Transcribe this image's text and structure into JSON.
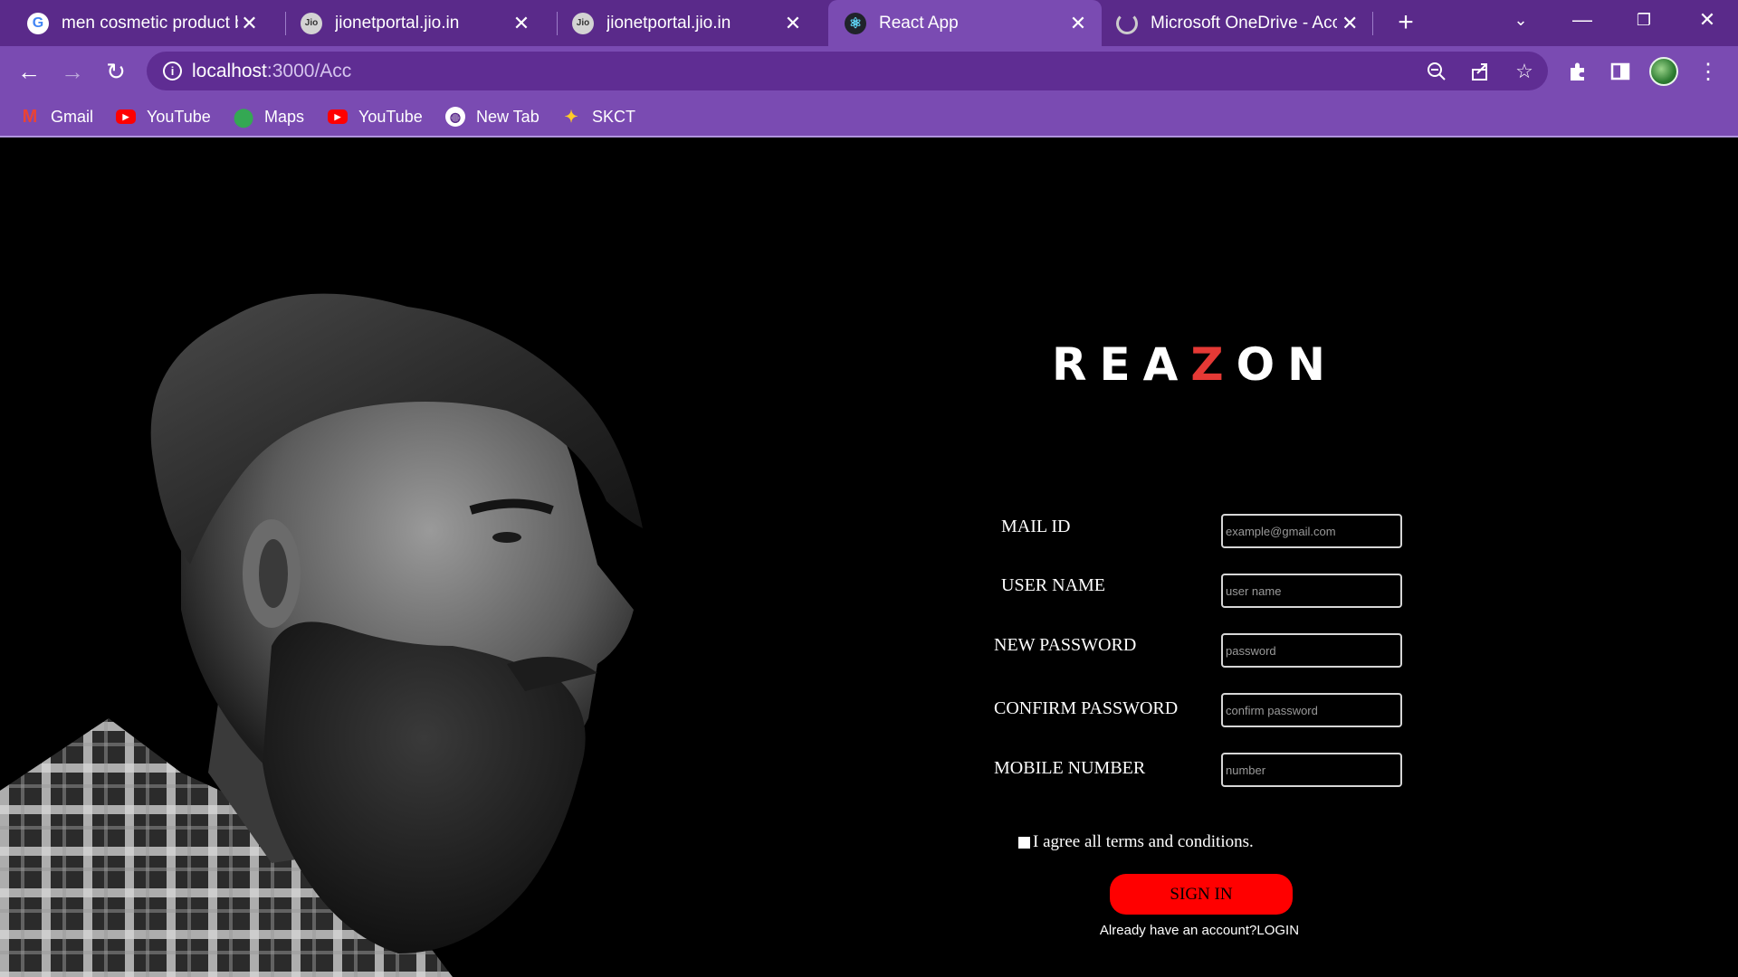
{
  "browser": {
    "tabs": [
      {
        "title": "men cosmetic product bla",
        "favicon": "google-icon"
      },
      {
        "title": "jionetportal.jio.in",
        "favicon": "jio-icon"
      },
      {
        "title": "jionetportal.jio.in",
        "favicon": "jio-icon"
      },
      {
        "title": "React App",
        "favicon": "react-icon",
        "active": true
      },
      {
        "title": "Microsoft OneDrive - Acc",
        "favicon": "loading-spinner-icon"
      }
    ],
    "favicon_text": {
      "google": "G",
      "jio": "Jio",
      "react": "⚛"
    },
    "address": {
      "host": "localhost",
      "path": ":3000/Acc"
    },
    "bookmarks": [
      {
        "label": "Gmail",
        "icon": "gmail-icon"
      },
      {
        "label": "YouTube",
        "icon": "youtube-icon"
      },
      {
        "label": "Maps",
        "icon": "maps-icon"
      },
      {
        "label": "YouTube",
        "icon": "youtube-icon"
      },
      {
        "label": "New Tab",
        "icon": "globe-icon"
      },
      {
        "label": "SKCT",
        "icon": "skct-icon"
      }
    ],
    "colors": {
      "tabstrip": "#5a2a8a",
      "toolbar": "#7a4bb2",
      "omnibox": "#5f2d93"
    }
  },
  "page": {
    "logo": {
      "part1": "REA",
      "accent": "Z",
      "part2": "ON"
    },
    "form": {
      "fields": [
        {
          "label": "MAIL ID",
          "placeholder": "example@gmail.com"
        },
        {
          "label": "USER NAME",
          "placeholder": "user name"
        },
        {
          "label": "NEW PASSWORD",
          "placeholder": "password"
        },
        {
          "label": "CONFIRM PASSWORD",
          "placeholder": "confirm password"
        },
        {
          "label": "MOBILE NUMBER",
          "placeholder": "number"
        }
      ],
      "terms": "I agree all terms and conditions.",
      "submit": "SIGN IN",
      "login_prompt": "Already have an account?LOGIN"
    },
    "colors": {
      "accent": "#e53935",
      "button": "#ff0000",
      "background": "#000000"
    }
  }
}
